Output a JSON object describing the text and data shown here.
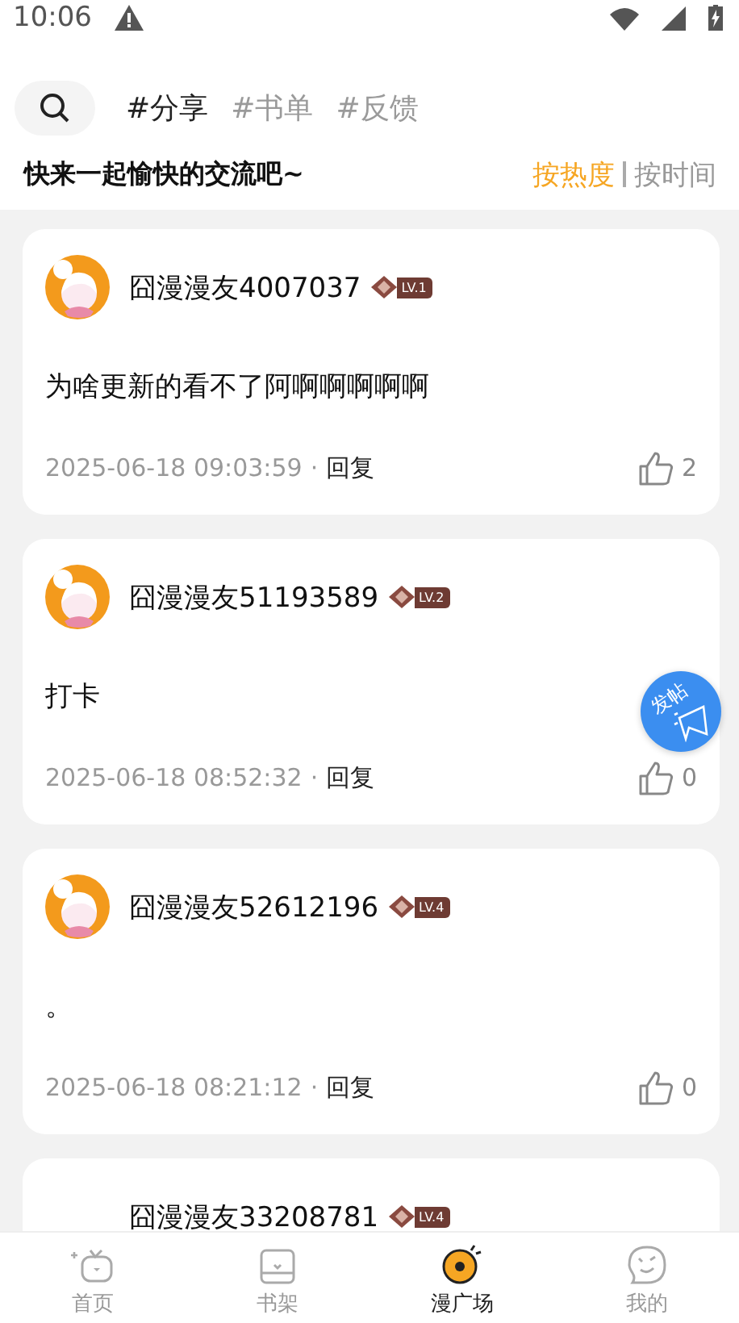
{
  "status_bar": {
    "time": "10:06"
  },
  "topics": [
    {
      "label": "#分享",
      "selected": true
    },
    {
      "label": "#书单",
      "selected": false
    },
    {
      "label": "#反馈",
      "selected": false
    }
  ],
  "subtitle": "快来一起愉快的交流吧~",
  "sort_options": [
    {
      "label": "按热度",
      "selected": true
    },
    {
      "label": "按时间",
      "selected": false
    }
  ],
  "posts": [
    {
      "username": "囧漫漫友4007037",
      "level": "LV.1",
      "has_avatar": true,
      "content": "为啥更新的看不了阿啊啊啊啊啊",
      "time": "2025-06-18 09:03:59",
      "separator": "·",
      "reply": "回复",
      "likes": "2"
    },
    {
      "username": "囧漫漫友51193589",
      "level": "LV.2",
      "has_avatar": true,
      "content": "打卡",
      "time": "2025-06-18 08:52:32",
      "separator": "·",
      "reply": "回复",
      "likes": "0"
    },
    {
      "username": "囧漫漫友52612196",
      "level": "LV.4",
      "has_avatar": true,
      "content": "。",
      "time": "2025-06-18 08:21:12",
      "separator": "·",
      "reply": "回复",
      "likes": "0"
    },
    {
      "username": "囧漫漫友33208781",
      "level": "LV.4",
      "has_avatar": false
    }
  ],
  "fab": {
    "label": "发帖"
  },
  "nav": [
    {
      "kind": "home",
      "label": "首页",
      "selected": false
    },
    {
      "kind": "shelf",
      "label": "书架",
      "selected": false
    },
    {
      "kind": "plaza",
      "label": "漫广场",
      "selected": true
    },
    {
      "kind": "me",
      "label": "我的",
      "selected": false
    }
  ]
}
